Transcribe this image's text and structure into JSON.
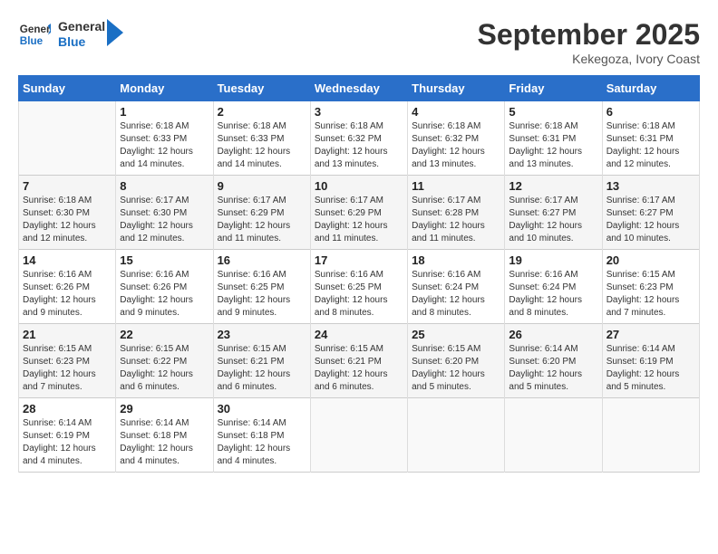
{
  "header": {
    "logo_line1": "General",
    "logo_line2": "Blue",
    "month": "September 2025",
    "location": "Kekegoza, Ivory Coast"
  },
  "weekdays": [
    "Sunday",
    "Monday",
    "Tuesday",
    "Wednesday",
    "Thursday",
    "Friday",
    "Saturday"
  ],
  "weeks": [
    [
      {
        "day": "",
        "empty": true
      },
      {
        "day": "1",
        "sunrise": "6:18 AM",
        "sunset": "6:33 PM",
        "daylight": "12 hours and 14 minutes."
      },
      {
        "day": "2",
        "sunrise": "6:18 AM",
        "sunset": "6:33 PM",
        "daylight": "12 hours and 14 minutes."
      },
      {
        "day": "3",
        "sunrise": "6:18 AM",
        "sunset": "6:32 PM",
        "daylight": "12 hours and 13 minutes."
      },
      {
        "day": "4",
        "sunrise": "6:18 AM",
        "sunset": "6:32 PM",
        "daylight": "12 hours and 13 minutes."
      },
      {
        "day": "5",
        "sunrise": "6:18 AM",
        "sunset": "6:31 PM",
        "daylight": "12 hours and 13 minutes."
      },
      {
        "day": "6",
        "sunrise": "6:18 AM",
        "sunset": "6:31 PM",
        "daylight": "12 hours and 12 minutes."
      }
    ],
    [
      {
        "day": "7",
        "sunrise": "6:18 AM",
        "sunset": "6:30 PM",
        "daylight": "12 hours and 12 minutes."
      },
      {
        "day": "8",
        "sunrise": "6:17 AM",
        "sunset": "6:30 PM",
        "daylight": "12 hours and 12 minutes."
      },
      {
        "day": "9",
        "sunrise": "6:17 AM",
        "sunset": "6:29 PM",
        "daylight": "12 hours and 11 minutes."
      },
      {
        "day": "10",
        "sunrise": "6:17 AM",
        "sunset": "6:29 PM",
        "daylight": "12 hours and 11 minutes."
      },
      {
        "day": "11",
        "sunrise": "6:17 AM",
        "sunset": "6:28 PM",
        "daylight": "12 hours and 11 minutes."
      },
      {
        "day": "12",
        "sunrise": "6:17 AM",
        "sunset": "6:27 PM",
        "daylight": "12 hours and 10 minutes."
      },
      {
        "day": "13",
        "sunrise": "6:17 AM",
        "sunset": "6:27 PM",
        "daylight": "12 hours and 10 minutes."
      }
    ],
    [
      {
        "day": "14",
        "sunrise": "6:16 AM",
        "sunset": "6:26 PM",
        "daylight": "12 hours and 9 minutes."
      },
      {
        "day": "15",
        "sunrise": "6:16 AM",
        "sunset": "6:26 PM",
        "daylight": "12 hours and 9 minutes."
      },
      {
        "day": "16",
        "sunrise": "6:16 AM",
        "sunset": "6:25 PM",
        "daylight": "12 hours and 9 minutes."
      },
      {
        "day": "17",
        "sunrise": "6:16 AM",
        "sunset": "6:25 PM",
        "daylight": "12 hours and 8 minutes."
      },
      {
        "day": "18",
        "sunrise": "6:16 AM",
        "sunset": "6:24 PM",
        "daylight": "12 hours and 8 minutes."
      },
      {
        "day": "19",
        "sunrise": "6:16 AM",
        "sunset": "6:24 PM",
        "daylight": "12 hours and 8 minutes."
      },
      {
        "day": "20",
        "sunrise": "6:15 AM",
        "sunset": "6:23 PM",
        "daylight": "12 hours and 7 minutes."
      }
    ],
    [
      {
        "day": "21",
        "sunrise": "6:15 AM",
        "sunset": "6:23 PM",
        "daylight": "12 hours and 7 minutes."
      },
      {
        "day": "22",
        "sunrise": "6:15 AM",
        "sunset": "6:22 PM",
        "daylight": "12 hours and 6 minutes."
      },
      {
        "day": "23",
        "sunrise": "6:15 AM",
        "sunset": "6:21 PM",
        "daylight": "12 hours and 6 minutes."
      },
      {
        "day": "24",
        "sunrise": "6:15 AM",
        "sunset": "6:21 PM",
        "daylight": "12 hours and 6 minutes."
      },
      {
        "day": "25",
        "sunrise": "6:15 AM",
        "sunset": "6:20 PM",
        "daylight": "12 hours and 5 minutes."
      },
      {
        "day": "26",
        "sunrise": "6:14 AM",
        "sunset": "6:20 PM",
        "daylight": "12 hours and 5 minutes."
      },
      {
        "day": "27",
        "sunrise": "6:14 AM",
        "sunset": "6:19 PM",
        "daylight": "12 hours and 5 minutes."
      }
    ],
    [
      {
        "day": "28",
        "sunrise": "6:14 AM",
        "sunset": "6:19 PM",
        "daylight": "12 hours and 4 minutes."
      },
      {
        "day": "29",
        "sunrise": "6:14 AM",
        "sunset": "6:18 PM",
        "daylight": "12 hours and 4 minutes."
      },
      {
        "day": "30",
        "sunrise": "6:14 AM",
        "sunset": "6:18 PM",
        "daylight": "12 hours and 4 minutes."
      },
      {
        "day": "",
        "empty": true
      },
      {
        "day": "",
        "empty": true
      },
      {
        "day": "",
        "empty": true
      },
      {
        "day": "",
        "empty": true
      }
    ]
  ]
}
